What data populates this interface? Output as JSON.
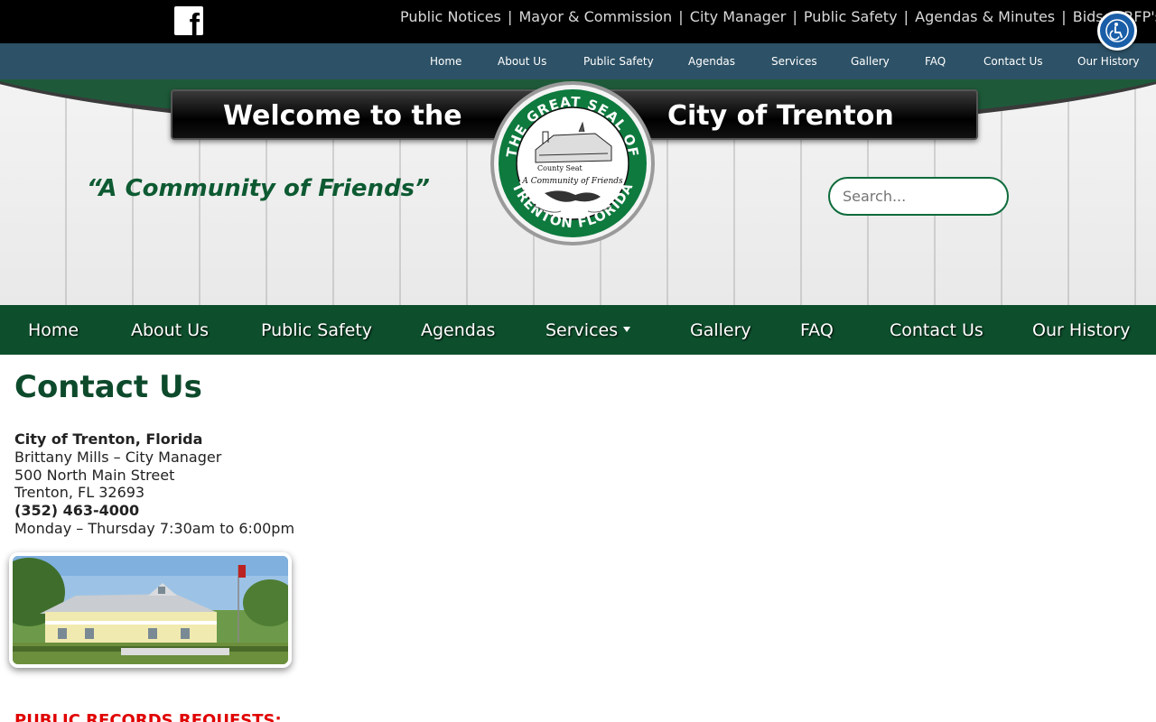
{
  "topbar": {
    "facebook_icon": "facebook-icon",
    "links": [
      "Public Notices",
      "Mayor & Commission",
      "City Manager",
      "Public Safety",
      "Agendas & Minutes",
      "Bids & RFP's"
    ],
    "separator": "|",
    "accessibility_icon": "accessibility-icon"
  },
  "subnav": {
    "items": [
      "Home",
      "About Us",
      "Public Safety",
      "Agendas",
      "Services",
      "Gallery",
      "FAQ",
      "Contact Us",
      "Our History"
    ]
  },
  "header": {
    "banner_left": "Welcome to the",
    "banner_right": "City of Trenton",
    "seal_top_text": "THE GREAT SEAL OF",
    "seal_bottom_text": "TRENTON FLORIDA",
    "seal_inner_1": "County Seat",
    "seal_inner_2": "A Community of Friends",
    "motto": "“A Community of Friends”",
    "search_placeholder": "Search..."
  },
  "mainnav": {
    "items": [
      "Home",
      "About Us",
      "Public Safety",
      "Agendas",
      "Services",
      "Gallery",
      "FAQ",
      "Contact Us",
      "Our History"
    ]
  },
  "content": {
    "title": "Contact Us",
    "address": {
      "org": "City of Trenton, Florida",
      "manager": "Brittany Mills – City Manager",
      "street": "500 North Main Street",
      "city": "Trenton, FL 32693",
      "phone": "(352) 463-4000",
      "hours": "Monday – Thursday 7:30am to 6:00pm"
    },
    "records_heading": "PUBLIC RECORDS REQUESTS:"
  },
  "colors": {
    "green_dark": "#0d4f2c",
    "nav_blue": "#2d5166",
    "title_green": "#0d4a2c",
    "alert_red": "#e00000"
  }
}
